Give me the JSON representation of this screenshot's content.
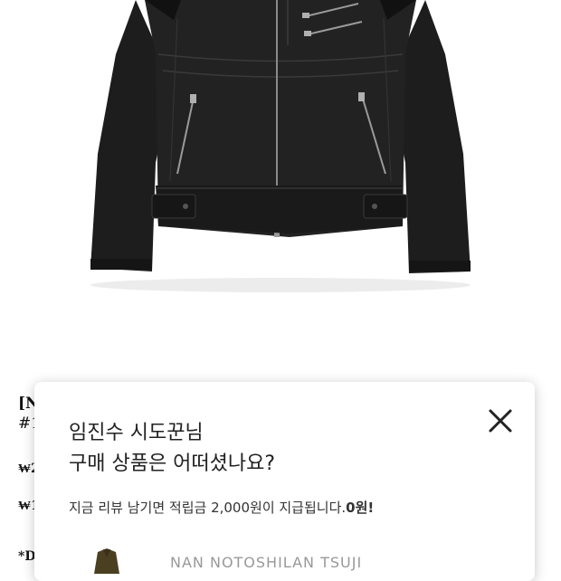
{
  "background_text": {
    "line1": "[N",
    "line2": "#1",
    "line3": "₩2",
    "line4": "₩1",
    "line5": "*D"
  },
  "review_modal": {
    "title_line1": "임진수 시도꾼님",
    "title_line2": "구매 상품은 어떠셨나요?",
    "subtitle_text": "지금 리뷰 남기면 적립금 2,000원이 지급됩니다.",
    "subtitle_bold": "0원!",
    "close_icon": "close-icon",
    "preview_text": "NAN NOTOSHILAN TSUJI"
  },
  "colors": {
    "jacket": "#1d1d1d",
    "modal_bg": "#ffffff",
    "text": "#222222"
  }
}
